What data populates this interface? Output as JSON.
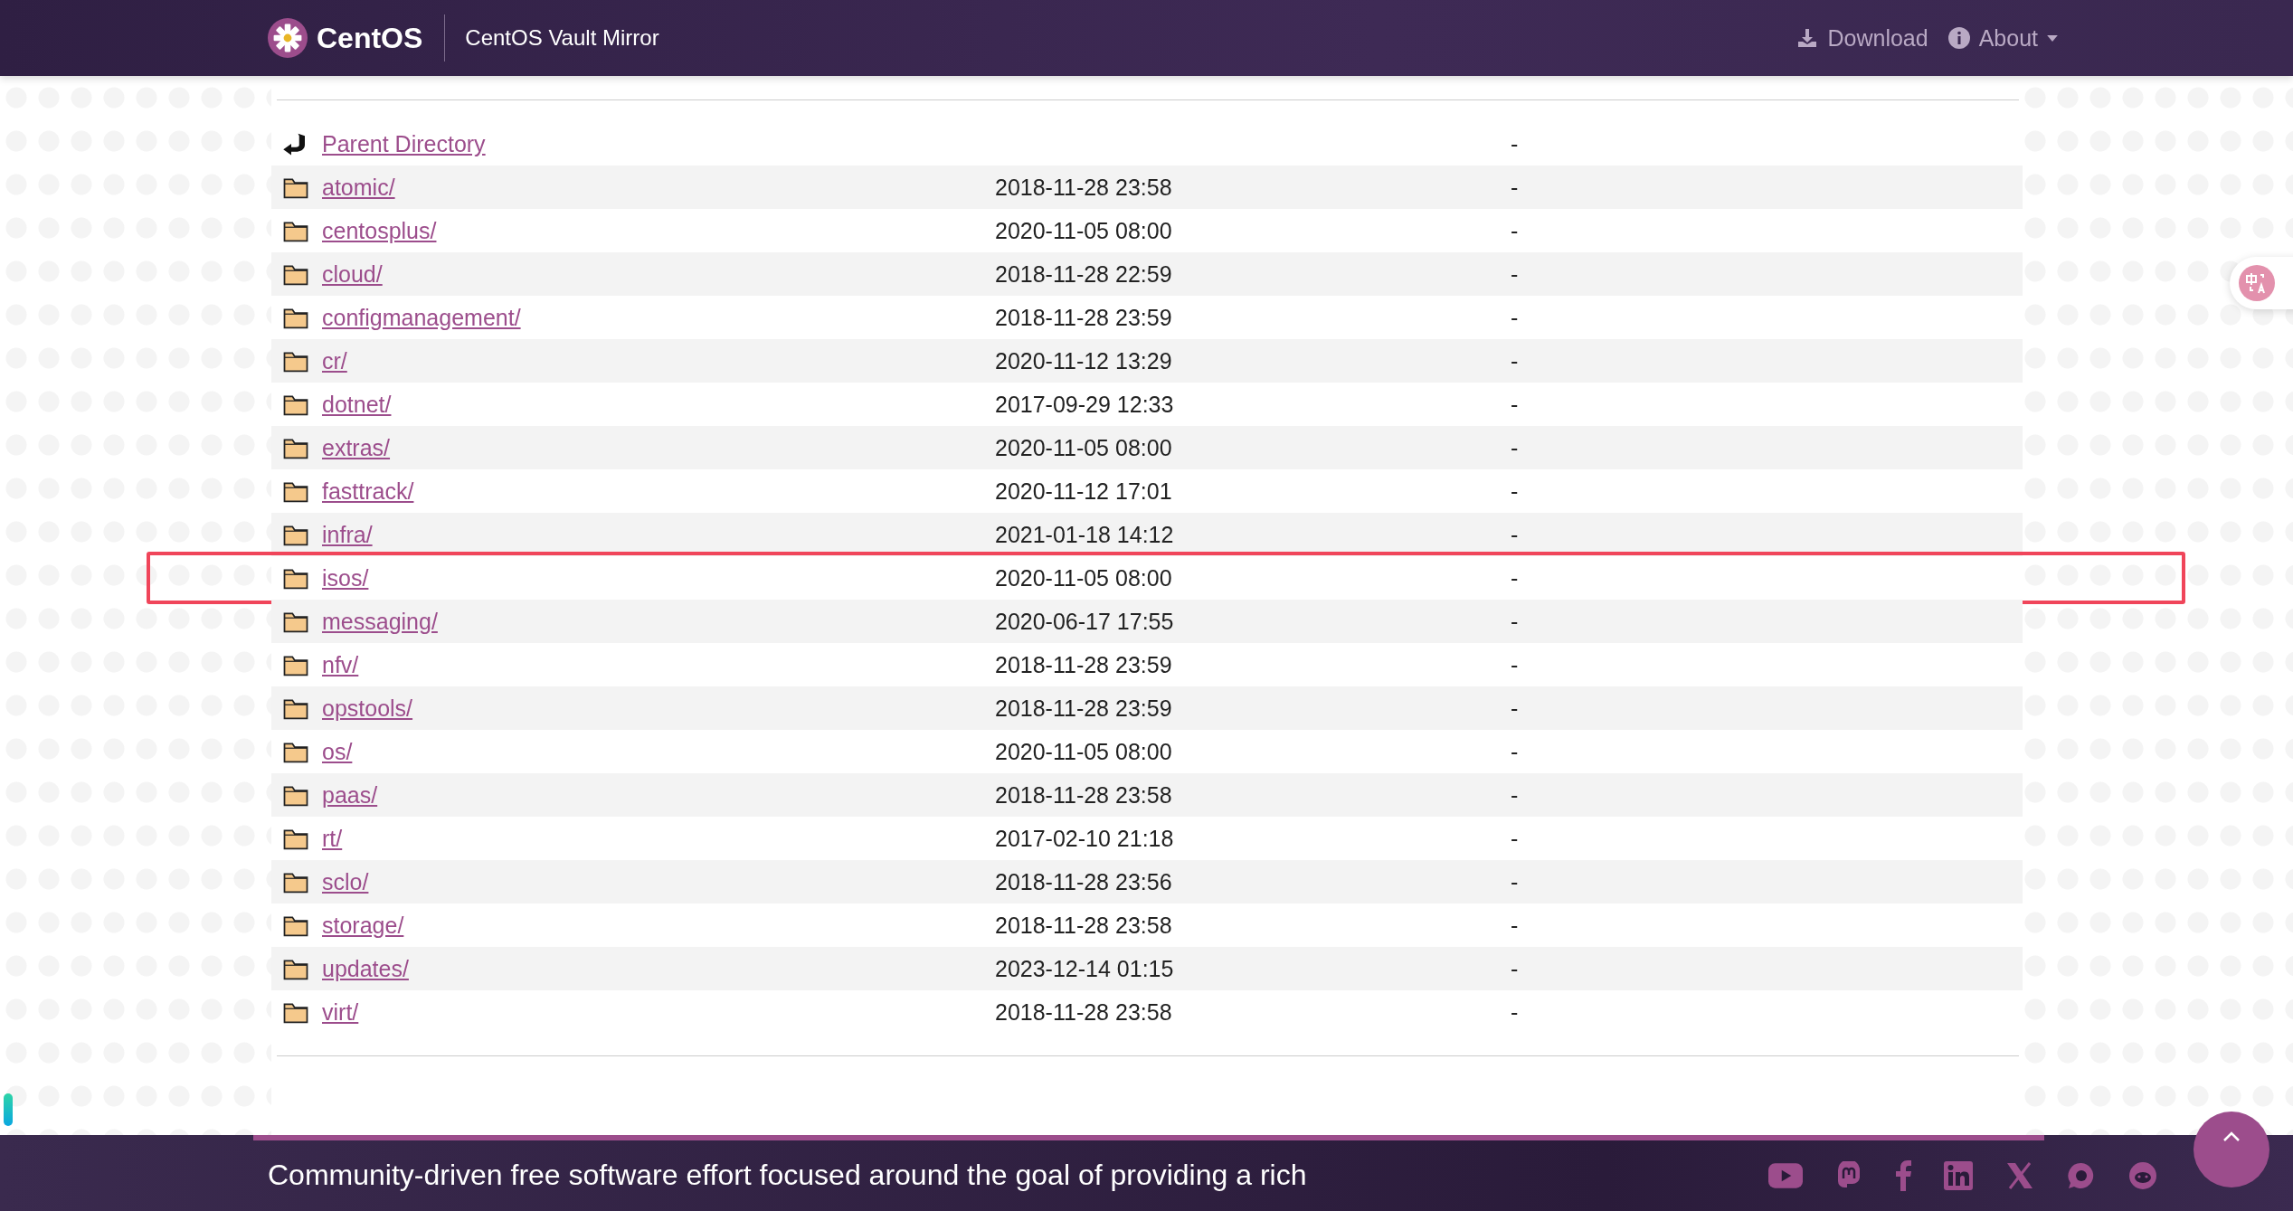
{
  "header": {
    "logo_text": "CentOS",
    "site_title": "CentOS Vault Mirror",
    "nav": [
      {
        "label": "Download",
        "kind": "download"
      },
      {
        "label": "About",
        "kind": "about"
      }
    ]
  },
  "listing": {
    "parent": {
      "name": "Parent Directory",
      "size": "-"
    },
    "rows": [
      {
        "name": "atomic/",
        "modified": "2018-11-28 23:58",
        "size": "-",
        "highlighted": false
      },
      {
        "name": "centosplus/",
        "modified": "2020-11-05 08:00",
        "size": "-",
        "highlighted": false
      },
      {
        "name": "cloud/",
        "modified": "2018-11-28 22:59",
        "size": "-",
        "highlighted": false
      },
      {
        "name": "configmanagement/",
        "modified": "2018-11-28 23:59",
        "size": "-",
        "highlighted": false
      },
      {
        "name": "cr/",
        "modified": "2020-11-12 13:29",
        "size": "-",
        "highlighted": false
      },
      {
        "name": "dotnet/",
        "modified": "2017-09-29 12:33",
        "size": "-",
        "highlighted": false
      },
      {
        "name": "extras/",
        "modified": "2020-11-05 08:00",
        "size": "-",
        "highlighted": false
      },
      {
        "name": "fasttrack/",
        "modified": "2020-11-12 17:01",
        "size": "-",
        "highlighted": false
      },
      {
        "name": "infra/",
        "modified": "2021-01-18 14:12",
        "size": "-",
        "highlighted": false
      },
      {
        "name": "isos/",
        "modified": "2020-11-05 08:00",
        "size": "-",
        "highlighted": true
      },
      {
        "name": "messaging/",
        "modified": "2020-06-17 17:55",
        "size": "-",
        "highlighted": false
      },
      {
        "name": "nfv/",
        "modified": "2018-11-28 23:59",
        "size": "-",
        "highlighted": false
      },
      {
        "name": "opstools/",
        "modified": "2018-11-28 23:59",
        "size": "-",
        "highlighted": false
      },
      {
        "name": "os/",
        "modified": "2020-11-05 08:00",
        "size": "-",
        "highlighted": false
      },
      {
        "name": "paas/",
        "modified": "2018-11-28 23:58",
        "size": "-",
        "highlighted": false
      },
      {
        "name": "rt/",
        "modified": "2017-02-10 21:18",
        "size": "-",
        "highlighted": false
      },
      {
        "name": "sclo/",
        "modified": "2018-11-28 23:56",
        "size": "-",
        "highlighted": false
      },
      {
        "name": "storage/",
        "modified": "2018-11-28 23:58",
        "size": "-",
        "highlighted": false
      },
      {
        "name": "updates/",
        "modified": "2023-12-14 01:15",
        "size": "-",
        "highlighted": false
      },
      {
        "name": "virt/",
        "modified": "2018-11-28 23:58",
        "size": "-",
        "highlighted": false
      }
    ]
  },
  "footer": {
    "text": "Community-driven free software effort focused around the goal of providing a rich",
    "social": [
      {
        "kind": "youtube"
      },
      {
        "kind": "mastodon"
      },
      {
        "kind": "facebook"
      },
      {
        "kind": "linkedin"
      },
      {
        "kind": "x"
      },
      {
        "kind": "chat"
      },
      {
        "kind": "reddit"
      }
    ]
  }
}
